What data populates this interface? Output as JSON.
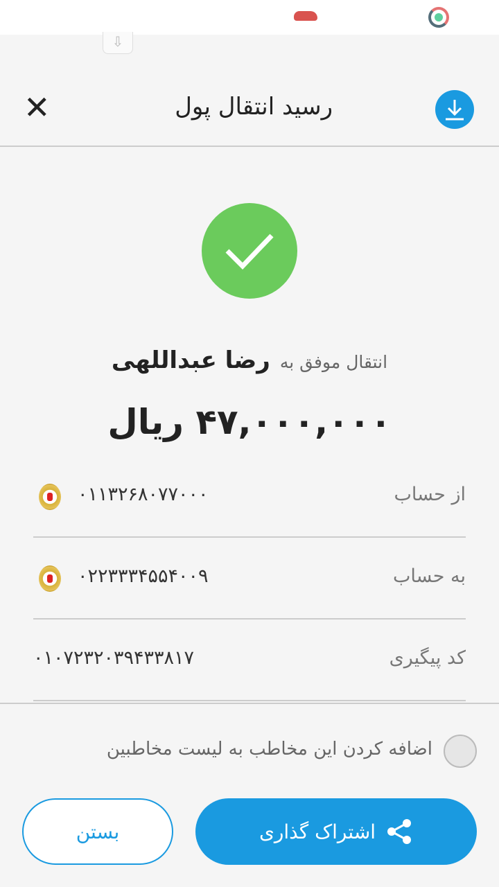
{
  "header": {
    "title": "رسید انتقال پول"
  },
  "summary": {
    "label": "انتقال موفق به",
    "recipient": "رضا عبداللهی",
    "amount": "۴۷,۰۰۰,۰۰۰ ریال"
  },
  "rows": [
    {
      "label": "از حساب",
      "value": "۰۱۱۳۲۶۸۰۷۷۰۰۰",
      "icon": "bank-melli-emblem"
    },
    {
      "label": "به حساب",
      "value": "۰۲۲۳۳۳۴۵۵۴۰۰۹",
      "icon": "bank-melli-emblem"
    },
    {
      "label": "کد پیگیری",
      "value": "۰۱۰۷۲۳۲۰۳۹۴۳۳۸۱۷"
    }
  ],
  "add_contact": {
    "label": "اضافه کردن این مخاطب به لیست مخاطبین",
    "checked": false
  },
  "buttons": {
    "share": "اشتراک گذاری",
    "close": "بستن"
  },
  "colors": {
    "accent": "#1a9ae0",
    "success": "#6bcb5c"
  }
}
